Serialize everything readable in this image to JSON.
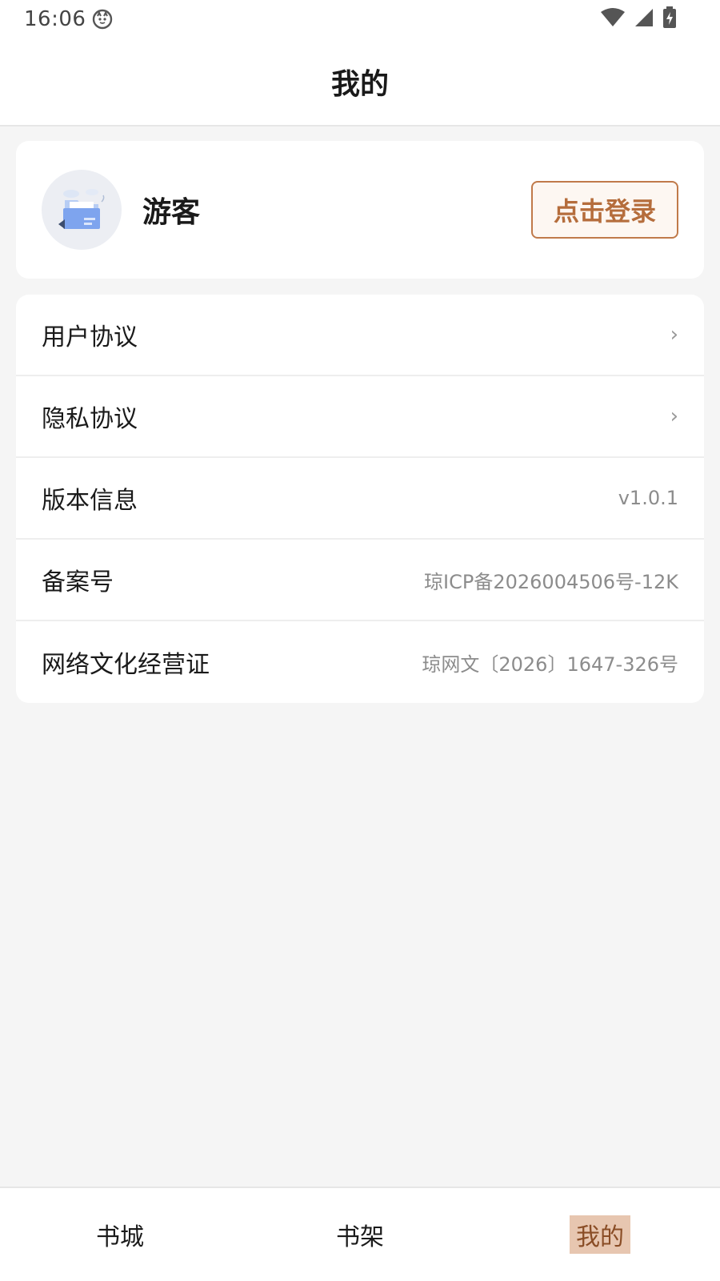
{
  "status_bar": {
    "time": "16:06",
    "icons": [
      "cat-icon",
      "wifi-icon",
      "signal-icon",
      "battery-charging-icon"
    ]
  },
  "header": {
    "title": "我的"
  },
  "profile": {
    "name": "游客",
    "login_label": "点击登录",
    "avatar_icon": "folder-avatar-icon"
  },
  "menu": {
    "items": [
      {
        "label": "用户协议",
        "value": "",
        "chevron": "›"
      },
      {
        "label": "隐私协议",
        "value": "",
        "chevron": "›"
      },
      {
        "label": "版本信息",
        "value": "v1.0.1",
        "chevron": ""
      },
      {
        "label": "备案号",
        "value": "琼ICP备2026004506号-12K",
        "chevron": ""
      },
      {
        "label": "网络文化经营证",
        "value": "琼网文〔2026〕1647-326号",
        "chevron": ""
      }
    ]
  },
  "tabs": {
    "items": [
      {
        "label": "书城"
      },
      {
        "label": "书架"
      },
      {
        "label": "我的"
      }
    ],
    "active_index": 2
  },
  "colors": {
    "accent": "#b56d3c",
    "active_tab_bg": "#e7c6b0",
    "background": "#f5f5f5"
  }
}
